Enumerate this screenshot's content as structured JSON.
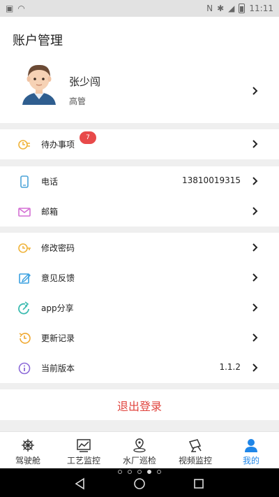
{
  "status_bar": {
    "time": "11:11"
  },
  "page": {
    "title": "账户管理"
  },
  "user": {
    "name": "张少闯",
    "role": "高管"
  },
  "todo": {
    "label": "待办事项",
    "badge": "7"
  },
  "contact": {
    "phone_label": "电话",
    "phone_value": "13810019315",
    "email_label": "邮箱"
  },
  "settings": {
    "items": [
      {
        "label": "修改密码",
        "icon": "password-icon"
      },
      {
        "label": "意见反馈",
        "icon": "feedback-icon"
      },
      {
        "label": "app分享",
        "icon": "share-icon"
      },
      {
        "label": "更新记录",
        "icon": "history-icon"
      },
      {
        "label": "当前版本",
        "icon": "info-icon",
        "value": "1.1.2"
      }
    ]
  },
  "logout": {
    "label": "退出登录"
  },
  "tabs": [
    {
      "label": "驾驶舱",
      "icon": "helm-icon"
    },
    {
      "label": "工艺监控",
      "icon": "chart-icon"
    },
    {
      "label": "水厂巡检",
      "icon": "location-icon"
    },
    {
      "label": "视频监控",
      "icon": "camera-icon"
    },
    {
      "label": "我的",
      "icon": "user-icon",
      "active": true
    }
  ],
  "colors": {
    "accent": "#1f86e8",
    "logout": "#e0443e",
    "badge": "#e84a4a"
  }
}
